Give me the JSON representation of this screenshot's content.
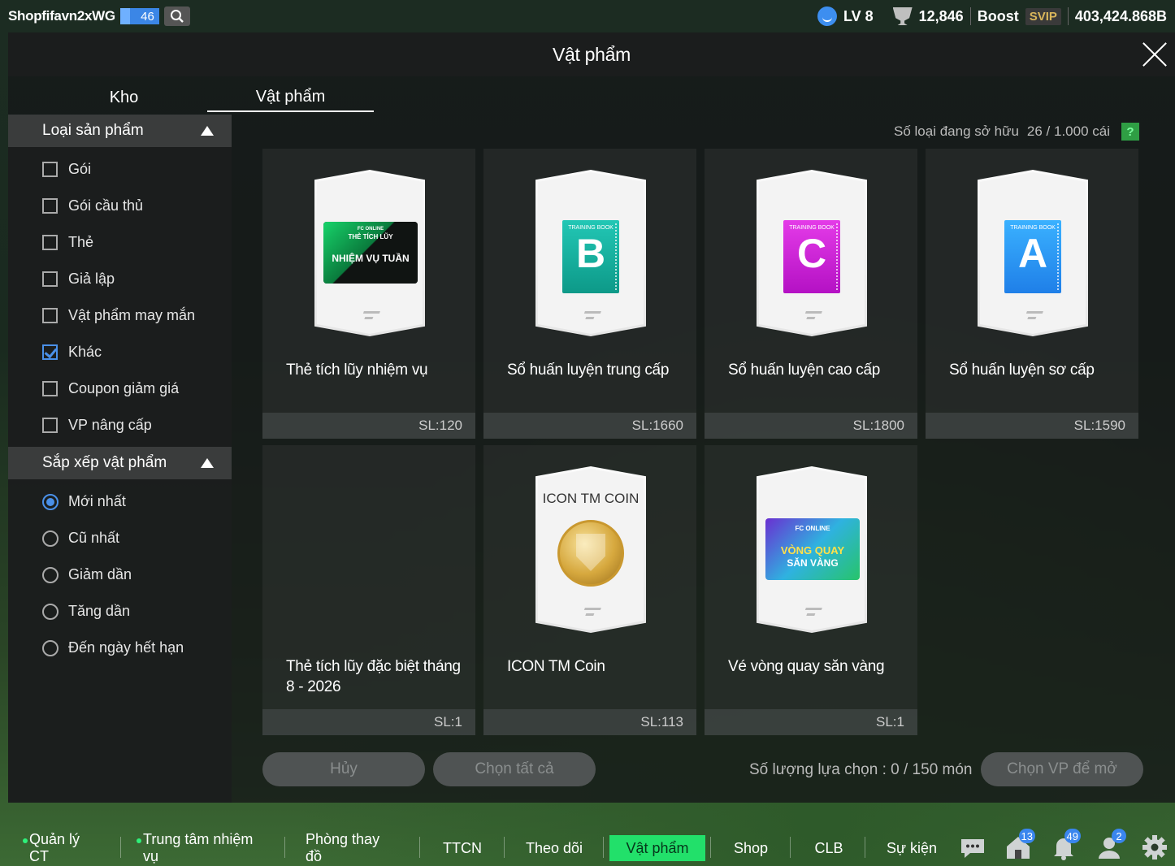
{
  "topbar": {
    "username": "Shopfifavn2xWG",
    "level": "46",
    "lv_label": "LV 8",
    "trophies": "12,846",
    "boost_label": "Boost",
    "svip_label": "SVIP",
    "balance": "403,424.868B"
  },
  "panel": {
    "title": "Vật phẩm"
  },
  "tabs": [
    {
      "label": "Kho"
    },
    {
      "label": "Vật phẩm"
    }
  ],
  "filter": {
    "title": "Loại sản phẩm",
    "options": [
      {
        "label": "Gói",
        "checked": false
      },
      {
        "label": "Gói cầu thủ",
        "checked": false
      },
      {
        "label": "Thẻ",
        "checked": false
      },
      {
        "label": "Giả lập",
        "checked": false
      },
      {
        "label": "Vật phẩm may mắn",
        "checked": false
      },
      {
        "label": "Khác",
        "checked": true
      },
      {
        "label": "Coupon giảm giá",
        "checked": false
      },
      {
        "label": "VP nâng cấp",
        "checked": false
      }
    ]
  },
  "sort": {
    "title": "Sắp xếp vật phẩm",
    "options": [
      {
        "label": "Mới nhất",
        "selected": true
      },
      {
        "label": "Cũ nhất",
        "selected": false
      },
      {
        "label": "Giảm dần",
        "selected": false
      },
      {
        "label": "Tăng dần",
        "selected": false
      },
      {
        "label": "Đến ngày hết hạn",
        "selected": false
      }
    ]
  },
  "owned": {
    "label": "Số loại đang sở hữu",
    "count": "26 / 1.000 cái",
    "help": "?"
  },
  "items": [
    {
      "name": "Thẻ tích lũy nhiệm vụ",
      "qty": "SL:120",
      "art": "voucher",
      "art_text": {
        "brand": "FC ONLINE",
        "sub": "THẺ TÍCH LŨY",
        "main": "NHIỆM VỤ TUẦN"
      }
    },
    {
      "name": "Sổ huấn luyện trung cấp",
      "qty": "SL:1660",
      "art": "book-b",
      "art_text": {
        "label": "TRAINING BOOK",
        "letter": "B"
      }
    },
    {
      "name": "Sổ huấn luyện cao cấp",
      "qty": "SL:1800",
      "art": "book-c",
      "art_text": {
        "label": "TRAINING BOOK",
        "letter": "C"
      }
    },
    {
      "name": "Sổ huấn luyện sơ cấp",
      "qty": "SL:1590",
      "art": "book-a",
      "art_text": {
        "label": "TRAINING BOOK",
        "letter": "A"
      }
    },
    {
      "name": "Thẻ tích lũy đặc biệt tháng 8 - 2026",
      "qty": "SL:1",
      "art": "none"
    },
    {
      "name": "ICON TM Coin",
      "qty": "SL:113",
      "art": "coin",
      "art_text": {
        "title": "ICON TM COIN"
      }
    },
    {
      "name": "Vé vòng quay săn vàng",
      "qty": "SL:1",
      "art": "ticket",
      "art_text": {
        "brand": "FC ONLINE",
        "main1": "VÒNG QUAY",
        "main2": "SĂN VÀNG"
      }
    }
  ],
  "actions": {
    "cancel": "Hủy",
    "select_all": "Chọn tất cả",
    "selection_label": "Số lượng lựa chọn : 0 / 150 món",
    "help": "?",
    "open": "Chọn VP để mở"
  },
  "bottomnav": {
    "items": [
      {
        "label": "Quản lý CT"
      },
      {
        "label": "Trung tâm nhiệm vụ"
      },
      {
        "label": "Phòng thay đồ"
      },
      {
        "label": "TTCN"
      },
      {
        "label": "Theo dõi"
      },
      {
        "label": "Vật phẩm"
      },
      {
        "label": "Shop"
      },
      {
        "label": "CLB"
      },
      {
        "label": "Sự kiện"
      }
    ],
    "badges": {
      "inbox": "13",
      "notifications": "49",
      "friends": "2"
    }
  },
  "colors": {
    "accent": "#22e06a",
    "checkbox": "#4a90e8",
    "help": "#2f9e44"
  },
  "icons": [
    "search-icon",
    "face-icon",
    "trophy-icon",
    "close-icon",
    "chat-icon",
    "inbox-icon",
    "bell-icon",
    "friends-icon",
    "gear-icon"
  ]
}
